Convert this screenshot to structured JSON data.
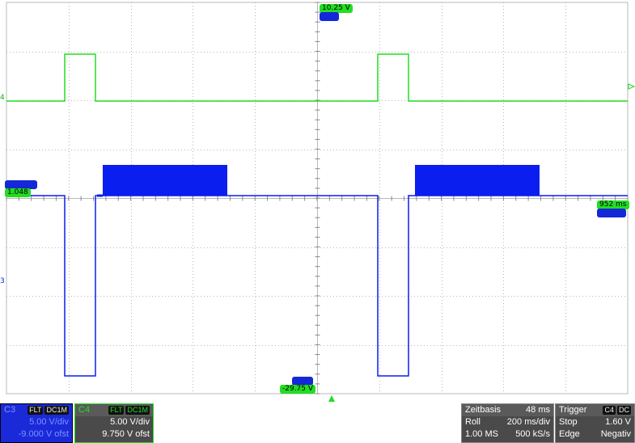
{
  "labels": {
    "top_level": "10.25 V",
    "ch4_level": "1.048",
    "bottom_level": "-29.75 V",
    "time_marker": "952 ms",
    "ch4_axis": "4",
    "ch3_axis": "3"
  },
  "ch3_panel": {
    "name": "C3",
    "flags": [
      "FLT",
      "DC1M"
    ],
    "vdiv": "5.00 V/div",
    "offset": "-9.000 V ofst",
    "color": "#1a2ad8"
  },
  "ch4_panel": {
    "name": "C4",
    "flags": [
      "FLT",
      "DC1M"
    ],
    "vdiv": "5.00 V/div",
    "offset": "9.750 V ofst",
    "color": "#22dd22"
  },
  "timebase": {
    "title": "Zeitbasis",
    "delay": "48 ms",
    "mode": "Roll",
    "tdiv": "200 ms/div",
    "points": "1.00 MS",
    "rate": "500 kS/s"
  },
  "trigger": {
    "title": "Trigger",
    "source": "C4",
    "coupling": "DC",
    "state": "Stop",
    "level": "1.60 V",
    "type": "Edge",
    "slope": "Negativ"
  },
  "colors": {
    "ch3": "#0a1ef0",
    "ch4": "#22dd22",
    "grid": "#b8b8b8"
  }
}
